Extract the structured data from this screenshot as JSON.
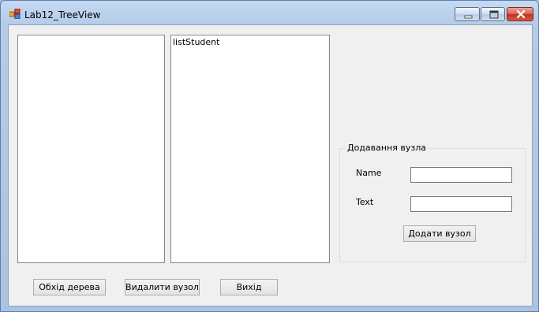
{
  "window": {
    "title": "Lab12_TreeView",
    "icon": "winforms-app-icon",
    "controls": {
      "minimize": "minimize-icon",
      "maximize": "maximize-icon",
      "close": "close-icon"
    }
  },
  "main": {
    "list1": {
      "items": []
    },
    "list2": {
      "items": [
        "listStudent"
      ]
    }
  },
  "group": {
    "legend": "Додавання вузла",
    "name_label": "Name",
    "name_value": "",
    "text_label": "Text",
    "text_value": "",
    "add_button": "Додати вузол"
  },
  "buttons": {
    "traverse": "Обхід дерева",
    "delete": "Видалити вузол",
    "exit": "Вихід"
  },
  "colors": {
    "titlebar": "#b4cce8",
    "client": "#f0f0f0",
    "close": "#c2301c"
  }
}
